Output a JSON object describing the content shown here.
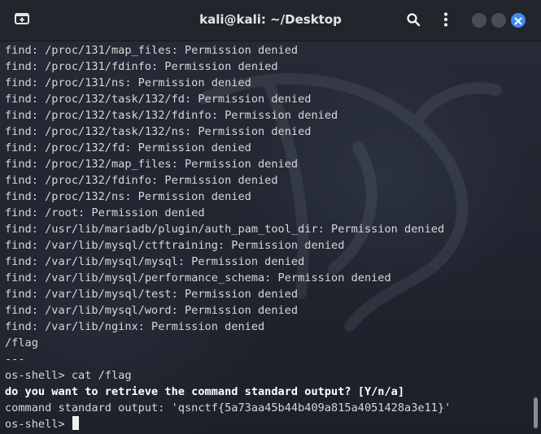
{
  "window": {
    "title": "kali@kali: ~/Desktop",
    "accent_color": "#3d8bf0"
  },
  "titlebar": {
    "new_tab_icon": "new-tab-icon",
    "search_icon": "search-icon",
    "menu_icon": "kebab-menu-icon",
    "close_icon": "close-icon"
  },
  "terminal": {
    "lines": [
      {
        "text": "find: /proc/131/map_files: Permission denied",
        "bold": false
      },
      {
        "text": "find: /proc/131/fdinfo: Permission denied",
        "bold": false
      },
      {
        "text": "find: /proc/131/ns: Permission denied",
        "bold": false
      },
      {
        "text": "find: /proc/132/task/132/fd: Permission denied",
        "bold": false
      },
      {
        "text": "find: /proc/132/task/132/fdinfo: Permission denied",
        "bold": false
      },
      {
        "text": "find: /proc/132/task/132/ns: Permission denied",
        "bold": false
      },
      {
        "text": "find: /proc/132/fd: Permission denied",
        "bold": false
      },
      {
        "text": "find: /proc/132/map_files: Permission denied",
        "bold": false
      },
      {
        "text": "find: /proc/132/fdinfo: Permission denied",
        "bold": false
      },
      {
        "text": "find: /proc/132/ns: Permission denied",
        "bold": false
      },
      {
        "text": "find: /root: Permission denied",
        "bold": false
      },
      {
        "text": "find: /usr/lib/mariadb/plugin/auth_pam_tool_dir: Permission denied",
        "bold": false
      },
      {
        "text": "find: /var/lib/mysql/ctftraining: Permission denied",
        "bold": false
      },
      {
        "text": "find: /var/lib/mysql/mysql: Permission denied",
        "bold": false
      },
      {
        "text": "find: /var/lib/mysql/performance_schema: Permission denied",
        "bold": false
      },
      {
        "text": "find: /var/lib/mysql/test: Permission denied",
        "bold": false
      },
      {
        "text": "find: /var/lib/mysql/word: Permission denied",
        "bold": false
      },
      {
        "text": "find: /var/lib/nginx: Permission denied",
        "bold": false
      },
      {
        "text": "/flag",
        "bold": false
      },
      {
        "text": "---",
        "bold": false
      },
      {
        "text": "os-shell> cat /flag",
        "bold": false
      },
      {
        "text": "do you want to retrieve the command standard output? [Y/n/a]",
        "bold": true
      },
      {
        "text": "command standard output: 'qsnctf{5a73aa45b44b409a815a4051428a3e11}'",
        "bold": false
      }
    ],
    "prompt": "os-shell> "
  }
}
